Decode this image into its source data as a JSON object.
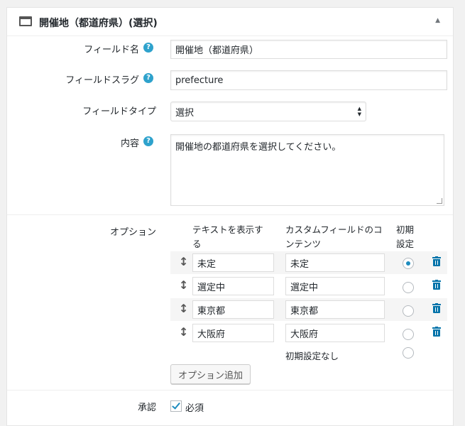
{
  "header": {
    "title": "開催地（都道府県）(選択)",
    "collapse_icon": "triangle-up"
  },
  "fields": {
    "name": {
      "label": "フィールド名",
      "value": "開催地（都道府県）",
      "help": "?"
    },
    "slug": {
      "label": "フィールドスラグ",
      "value": "prefecture",
      "help": "?"
    },
    "type": {
      "label": "フィールドタイプ",
      "value": "選択"
    },
    "content": {
      "label": "内容",
      "value": "開催地の都道府県を選択してください。",
      "help": "?"
    }
  },
  "options": {
    "label": "オプション",
    "columns": {
      "text": "テキストを表示する",
      "content": "カスタムフィールドのコンテンツ",
      "default": "初期設定"
    },
    "rows": [
      {
        "text": "未定",
        "content": "未定",
        "default": true
      },
      {
        "text": "選定中",
        "content": "選定中",
        "default": false
      },
      {
        "text": "東京都",
        "content": "東京都",
        "default": false
      },
      {
        "text": "大阪府",
        "content": "大阪府",
        "default": false
      }
    ],
    "no_default_label": "初期設定なし",
    "add_button": "オプション追加",
    "drag_glyph": "↕"
  },
  "approval": {
    "label": "承認",
    "checkbox_label": "必須",
    "checked": true
  },
  "colors": {
    "accent": "#0073aa",
    "help": "#2ea2cc",
    "radio_dot": "#1e8cbe"
  }
}
